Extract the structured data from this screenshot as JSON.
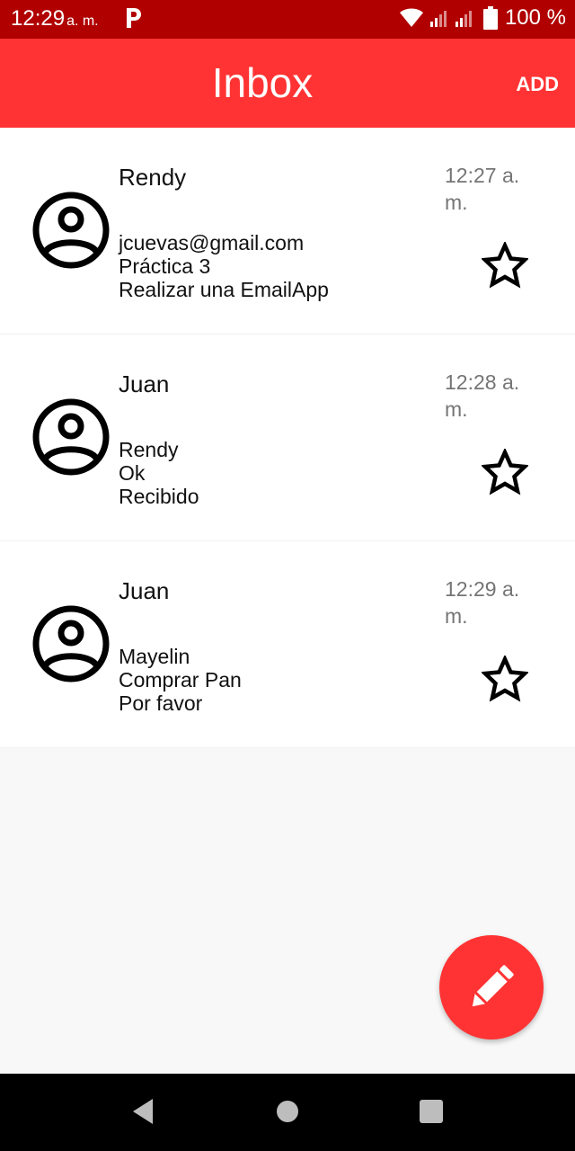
{
  "status_bar": {
    "time": "12:29",
    "ampm": "a. m.",
    "battery": "100 %",
    "icons": [
      "parking-icon",
      "wifi-icon",
      "signal-icon",
      "battery-icon"
    ]
  },
  "app_bar": {
    "title": "Inbox",
    "add_label": "ADD"
  },
  "emails": [
    {
      "sender": "Rendy",
      "time": "12:27 a. m.",
      "lines": [
        "jcuevas@gmail.com",
        "Práctica 3",
        "Realizar una EmailApp"
      ]
    },
    {
      "sender": "Juan",
      "time": "12:28 a. m.",
      "lines": [
        "Rendy",
        "Ok",
        "Recibido"
      ]
    },
    {
      "sender": "Juan",
      "time": "12:29 a. m.",
      "lines": [
        "Mayelin",
        "Comprar Pan",
        "Por favor"
      ]
    }
  ],
  "colors": {
    "status_bar": "#b00000",
    "accent": "#ff3333",
    "background": "#f8f8f8"
  },
  "fab": {
    "icon": "pencil-icon"
  },
  "nav": {
    "icons": [
      "back-icon",
      "home-icon",
      "recents-icon"
    ]
  }
}
